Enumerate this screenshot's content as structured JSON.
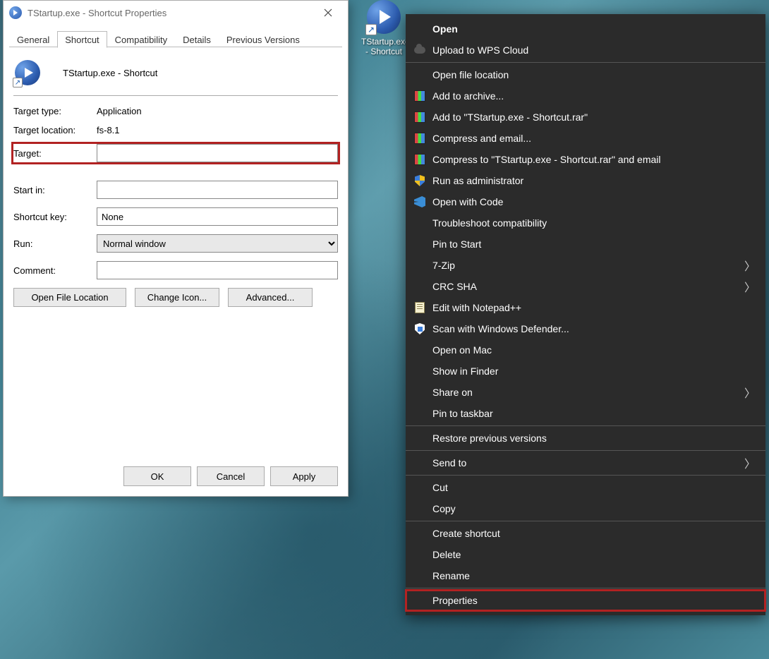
{
  "desktop": {
    "shortcut_label": "TStartup.exe\n- Shortcut"
  },
  "dialog": {
    "title": "TStartup.exe - Shortcut Properties",
    "tabs": [
      "General",
      "Shortcut",
      "Compatibility",
      "Details",
      "Previous Versions"
    ],
    "active_tab": "Shortcut",
    "header_name": "TStartup.exe - Shortcut",
    "target_type_label": "Target type:",
    "target_type_value": "Application",
    "target_location_label": "Target location:",
    "target_location_value": "fs-8.1",
    "target_label": "Target:",
    "target_value": "",
    "start_in_label": "Start in:",
    "start_in_value": "",
    "shortcut_key_label": "Shortcut key:",
    "shortcut_key_value": "None",
    "run_label": "Run:",
    "run_value": "Normal window",
    "comment_label": "Comment:",
    "comment_value": "",
    "open_file_location": "Open File Location",
    "change_icon": "Change Icon...",
    "advanced": "Advanced...",
    "ok": "OK",
    "cancel": "Cancel",
    "apply": "Apply"
  },
  "ctx": {
    "groups": [
      {
        "items": [
          {
            "label": "Open",
            "bold": true,
            "icon": ""
          },
          {
            "label": "Upload to WPS Cloud",
            "icon": "cloud"
          }
        ]
      },
      {
        "items": [
          {
            "label": "Open file location",
            "icon": ""
          },
          {
            "label": "Add to archive...",
            "icon": "books"
          },
          {
            "label": "Add to \"TStartup.exe - Shortcut.rar\"",
            "icon": "books"
          },
          {
            "label": "Compress and email...",
            "icon": "books"
          },
          {
            "label": "Compress to \"TStartup.exe - Shortcut.rar\" and email",
            "icon": "books"
          },
          {
            "label": "Run as administrator",
            "icon": "shield"
          },
          {
            "label": "Open with Code",
            "icon": "vscode"
          },
          {
            "label": "Troubleshoot compatibility",
            "icon": ""
          },
          {
            "label": "Pin to Start",
            "icon": ""
          },
          {
            "label": "7-Zip",
            "icon": "",
            "sub": true
          },
          {
            "label": "CRC SHA",
            "icon": "",
            "sub": true
          },
          {
            "label": "Edit with Notepad++",
            "icon": "notepad"
          },
          {
            "label": "Scan with Windows Defender...",
            "icon": "shield-def"
          },
          {
            "label": "Open on Mac",
            "icon": ""
          },
          {
            "label": "Show in Finder",
            "icon": ""
          },
          {
            "label": "Share on",
            "icon": "",
            "sub": true
          },
          {
            "label": "Pin to taskbar",
            "icon": ""
          }
        ]
      },
      {
        "items": [
          {
            "label": "Restore previous versions",
            "icon": ""
          }
        ]
      },
      {
        "items": [
          {
            "label": "Send to",
            "icon": "",
            "sub": true
          }
        ]
      },
      {
        "items": [
          {
            "label": "Cut",
            "icon": ""
          },
          {
            "label": "Copy",
            "icon": ""
          }
        ]
      },
      {
        "items": [
          {
            "label": "Create shortcut",
            "icon": ""
          },
          {
            "label": "Delete",
            "icon": ""
          },
          {
            "label": "Rename",
            "icon": ""
          }
        ]
      },
      {
        "items": [
          {
            "label": "Properties",
            "icon": "",
            "highlight": true
          }
        ]
      }
    ]
  }
}
